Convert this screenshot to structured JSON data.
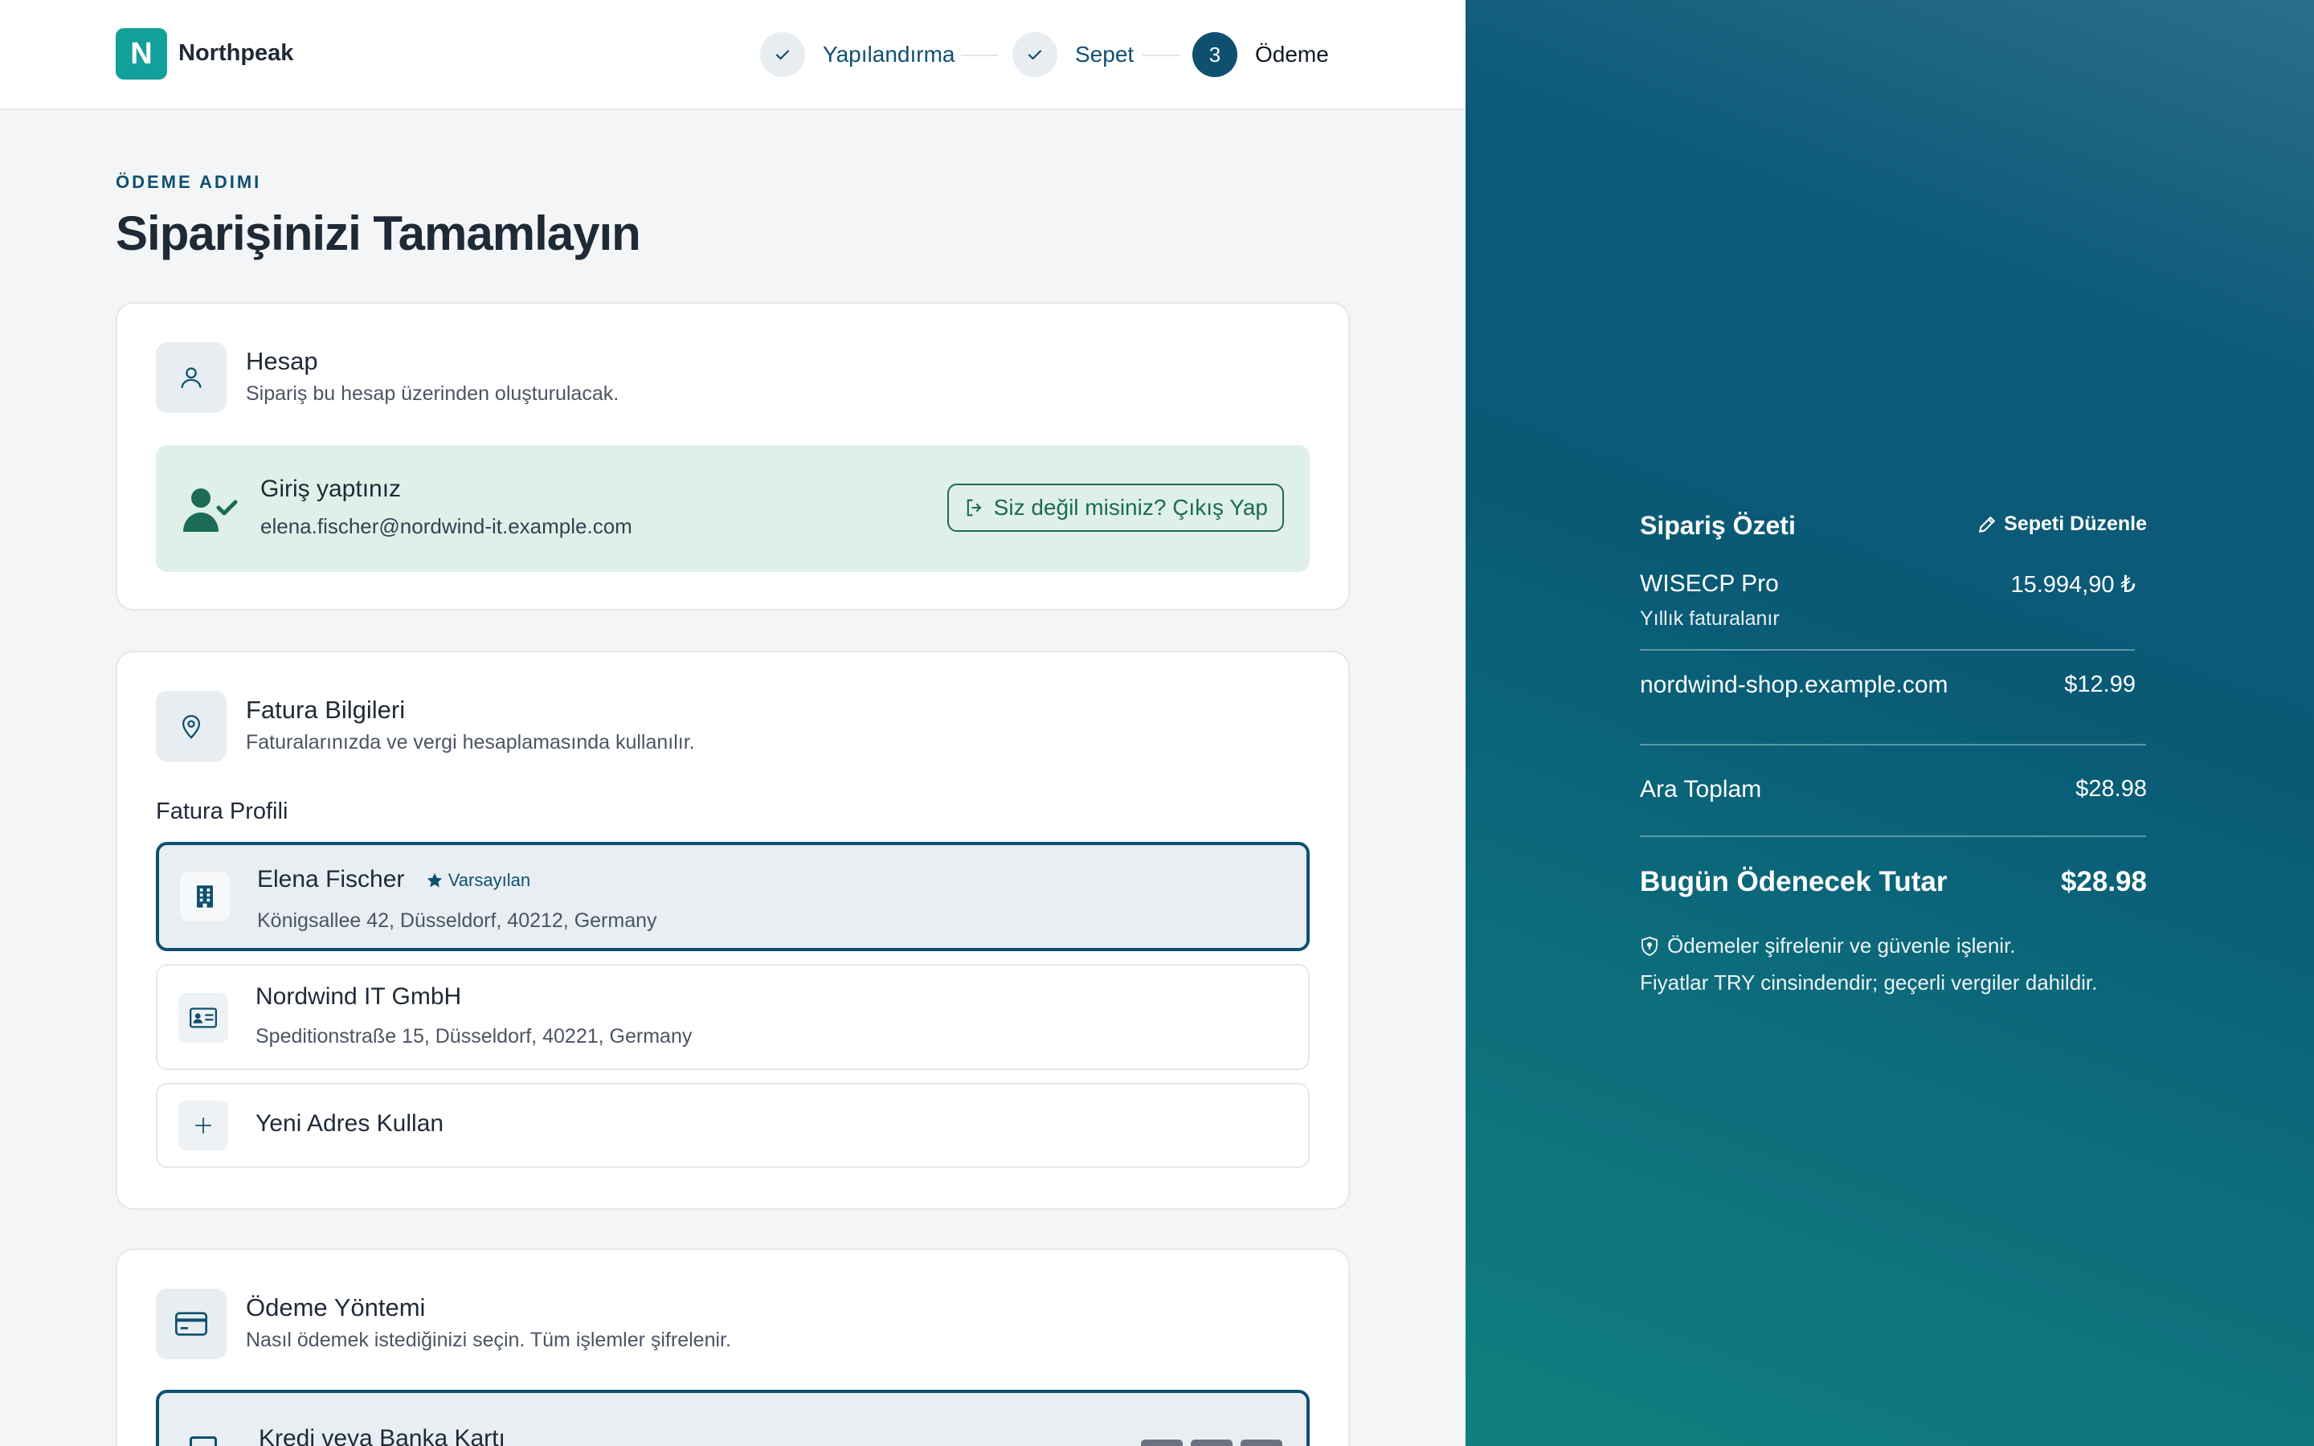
{
  "brand": {
    "logo_letter": "N",
    "name": "Northpeak",
    "color": "#14a09a"
  },
  "steps": [
    {
      "label": "Yapılandırma",
      "state": "done"
    },
    {
      "label": "Sepet",
      "state": "done"
    },
    {
      "number": "3",
      "label": "Ödeme",
      "state": "active"
    }
  ],
  "page": {
    "eyebrow": "ÖDEME ADIMI",
    "title": "Siparişinizi Tamamlayın"
  },
  "account": {
    "title": "Hesap",
    "subtitle": "Sipariş bu hesap üzerinden oluşturulacak.",
    "login_title": "Giriş yaptınız",
    "email": "elena.fischer@nordwind-it.example.com",
    "logout_label": "Siz değil misiniz? Çıkış Yap"
  },
  "billing": {
    "title": "Fatura Bilgileri",
    "subtitle": "Faturalarınızda ve vergi hesaplamasında kullanılır.",
    "profile_label": "Fatura Profili",
    "profiles": [
      {
        "name": "Elena Fischer",
        "badge": "Varsayılan",
        "address": "Königsallee 42, Düsseldorf, 40212, Germany",
        "selected": true
      },
      {
        "name": "Nordwind IT GmbH",
        "address": "Speditionstraße 15, Düsseldorf, 40221, Germany",
        "selected": false
      }
    ],
    "new_address_label": "Yeni Adres Kullan"
  },
  "payment": {
    "title": "Ödeme Yöntemi",
    "subtitle": "Nasıl ödemek istediğinizi seçin. Tüm işlemler şifrelenir.",
    "method_label": "Kredi veya Banka Kartı"
  },
  "summary": {
    "title": "Sipariş Özeti",
    "edit_label": "Sepeti Düzenle",
    "items": [
      {
        "name": "WISECP Pro",
        "price": "15.994,90 ₺",
        "sub": "Yıllık faturalanır"
      },
      {
        "name": "nordwind-shop.example.com",
        "price": "$12.99"
      }
    ],
    "subtotal_label": "Ara Toplam",
    "subtotal_value": "$28.98",
    "total_label": "Bugün Ödenecek Tutar",
    "total_value": "$28.98",
    "note_secure": "Ödemeler şifrelenir ve güvenle işlenir.",
    "note_currency": "Fiyatlar TRY cinsindendir; geçerli vergiler dahildir."
  },
  "colors": {
    "primary": "#0f5070",
    "success_bg": "#dff0e9",
    "success_text": "#1b6b57"
  }
}
